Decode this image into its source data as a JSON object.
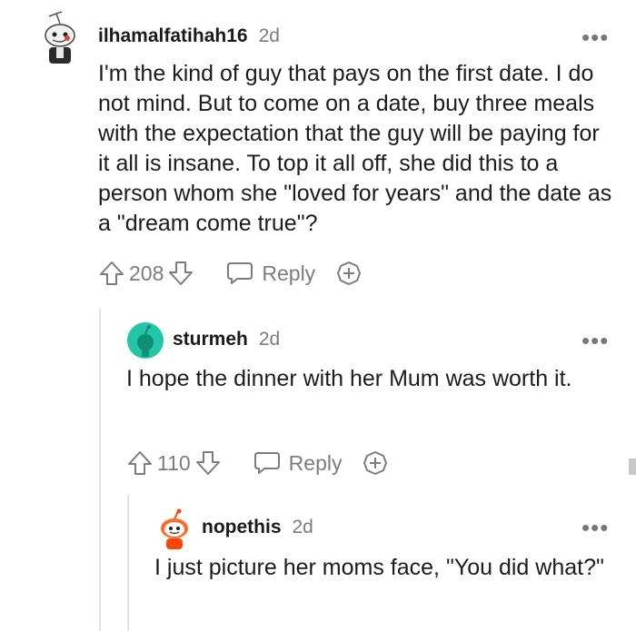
{
  "comments": [
    {
      "username": "ilhamalfatihah16",
      "time": "2d",
      "text": "I'm the kind of guy that pays on the first date. I do not mind. But to come on a date, buy three meals with the expectation that the guy will be paying for it all is insane. To top it all off, she did this to a person whom she \"loved for years\" and the date as a \"dream come true\"?",
      "votes": "208",
      "reply_label": "Reply",
      "more_label": "•••",
      "avatar": "snoo-avatar-gray"
    },
    {
      "username": "sturmeh",
      "time": "2d",
      "text": "I hope the dinner with her Mum was worth it.",
      "votes": "110",
      "reply_label": "Reply",
      "more_label": "•••",
      "avatar": "snoo-avatar-teal"
    },
    {
      "username": "nopethis",
      "time": "2d",
      "text": "I just picture her moms face, \"You did what?\"",
      "more_label": "•••",
      "avatar": "snoo-avatar-orange"
    }
  ],
  "colors": {
    "text": "#1c1c1c",
    "muted": "#7c7c7c",
    "thread_line": "#e3e3e3",
    "teal_avatar": "#24c4a6",
    "orange_avatar": "#ff4500"
  }
}
